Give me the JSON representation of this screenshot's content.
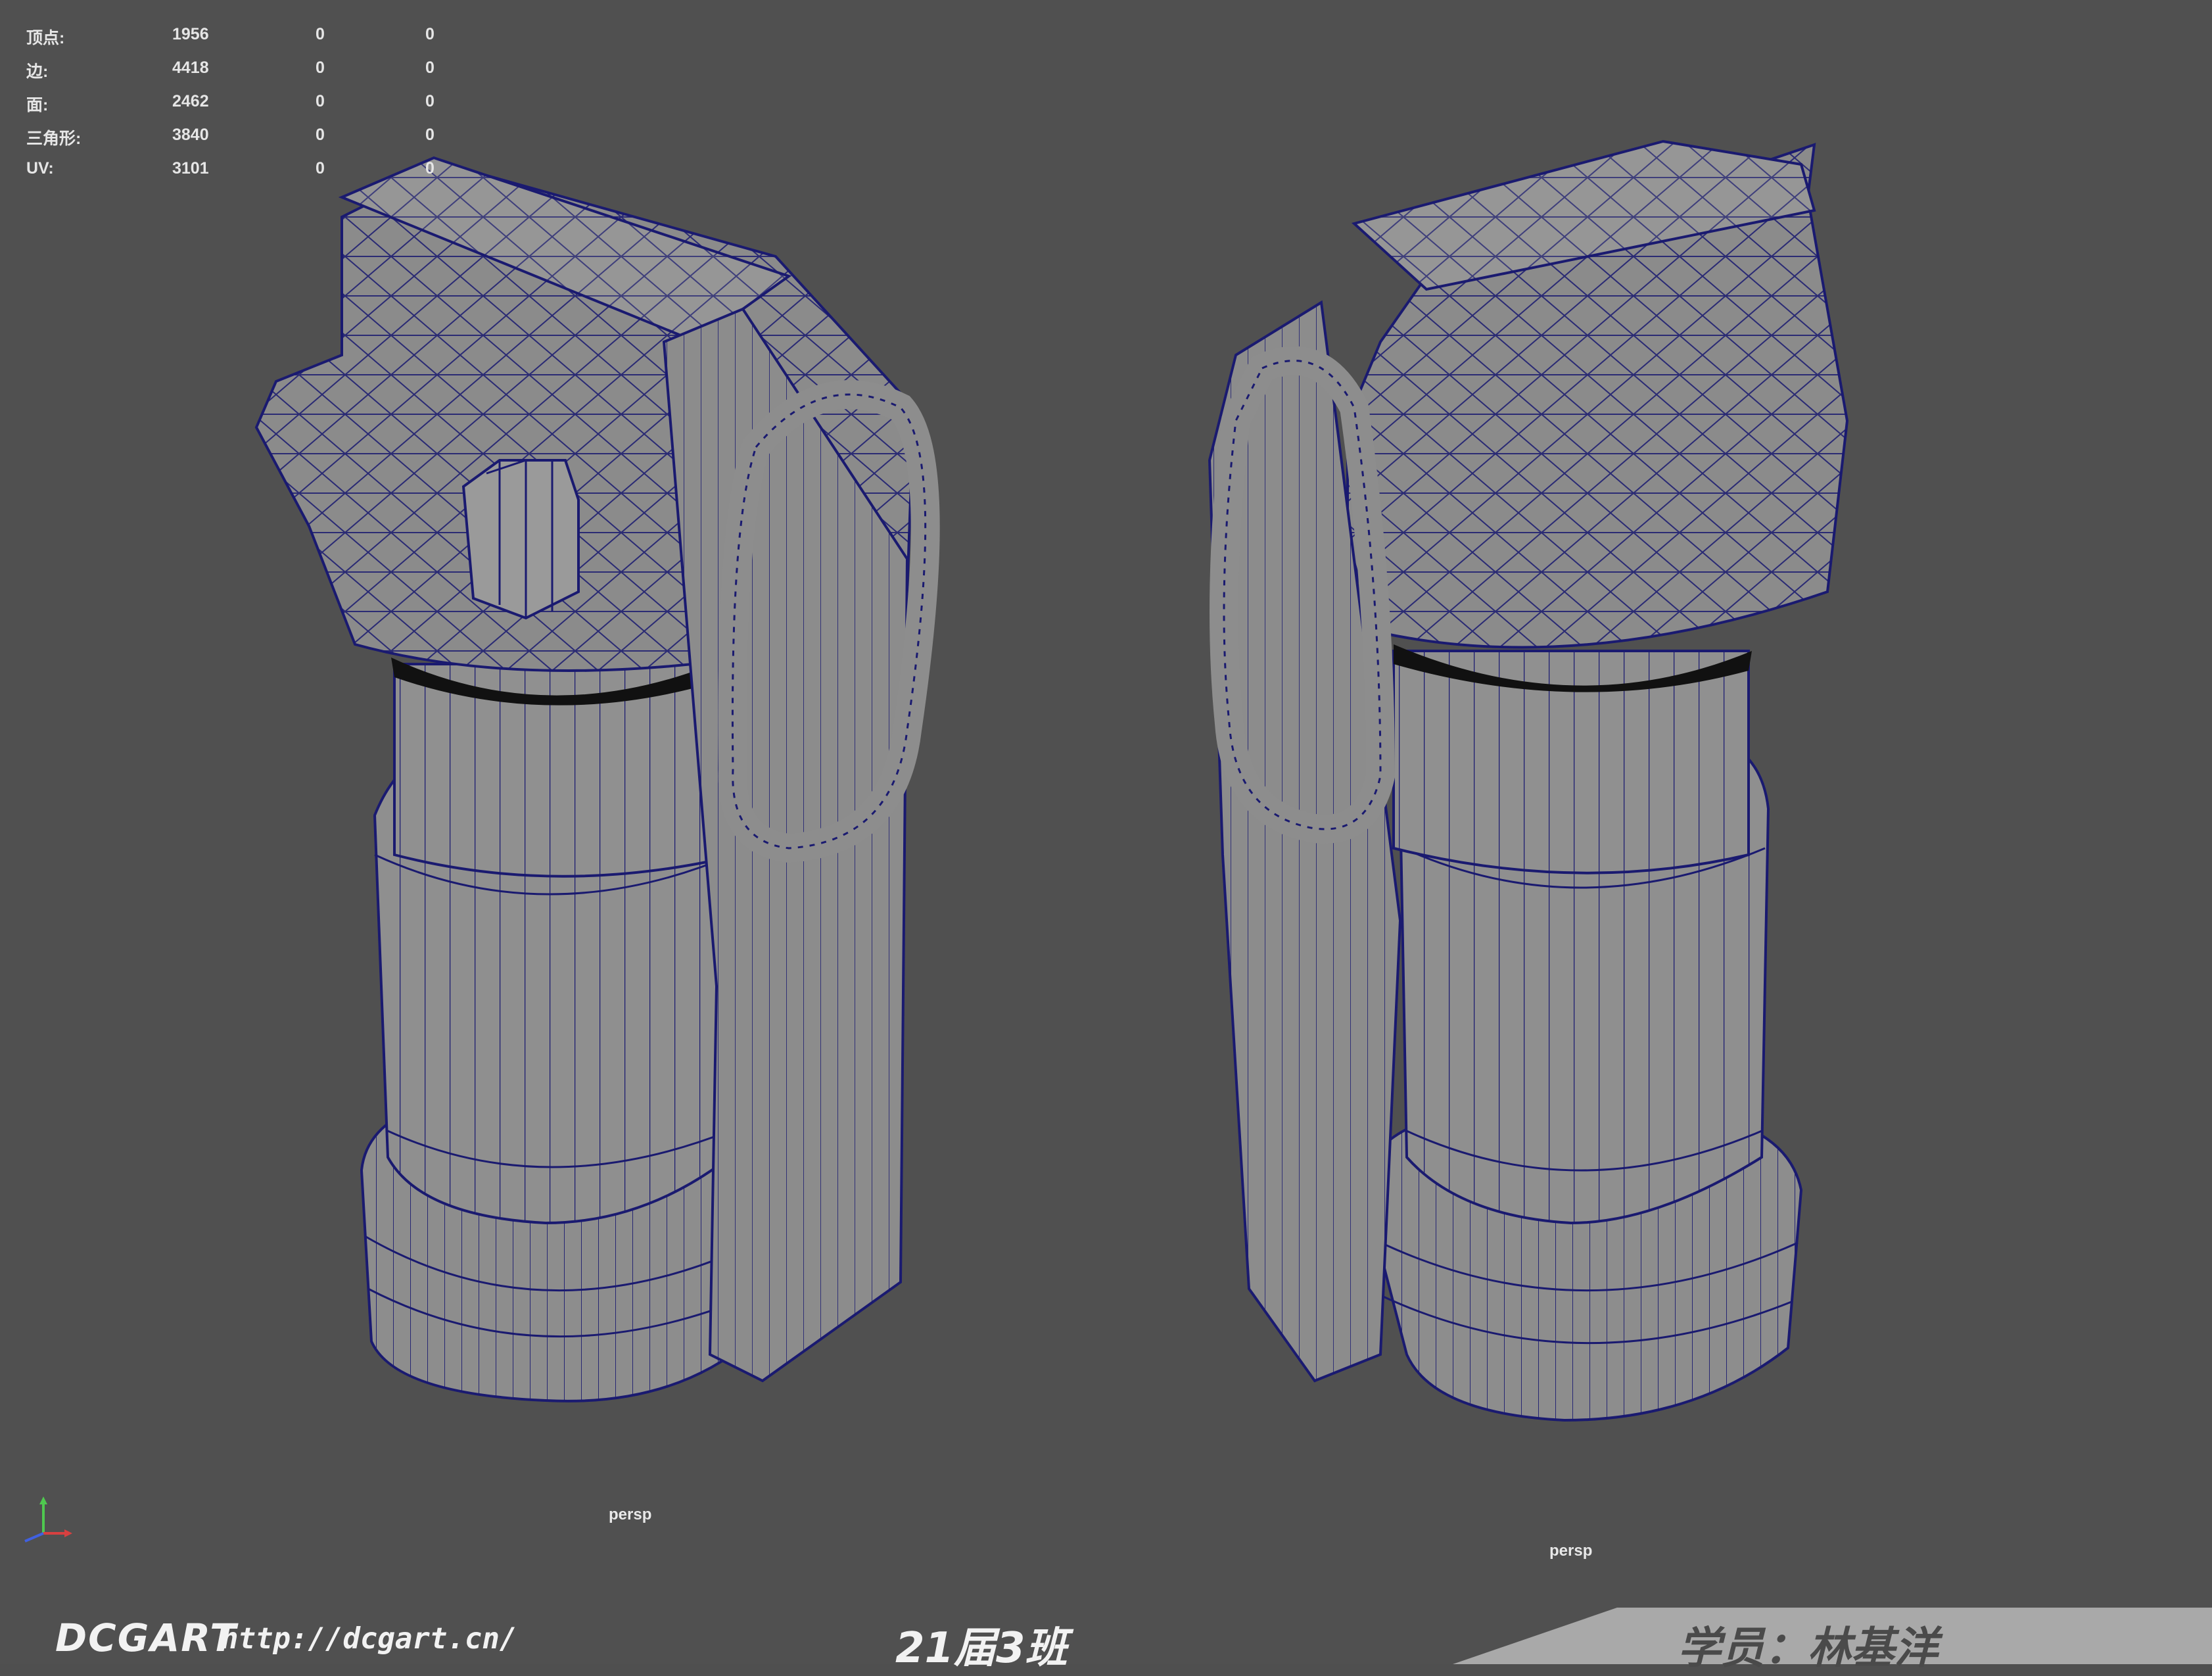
{
  "hud": {
    "rows": [
      {
        "label": "顶点:",
        "values": [
          "1956",
          "0",
          "0"
        ]
      },
      {
        "label": "边:",
        "values": [
          "4418",
          "0",
          "0"
        ]
      },
      {
        "label": "面:",
        "values": [
          "2462",
          "0",
          "0"
        ]
      },
      {
        "label": "三角形:",
        "values": [
          "3840",
          "0",
          "0"
        ]
      },
      {
        "label": "UV:",
        "values": [
          "3101",
          "0",
          "0"
        ]
      }
    ]
  },
  "viewports": {
    "left_camera": "persp",
    "right_camera": "persp"
  },
  "axis": {
    "y": "y",
    "x": "x",
    "z": "z"
  },
  "banner": {
    "brand": "DCGART",
    "url": "http://dcgart.cn/",
    "class_label": "21届3班",
    "student": "学员：林基洋"
  },
  "colors": {
    "viewport_bg": "#505050",
    "mesh_fill": "#8c8c8c",
    "wireframe": "#1a1a70",
    "banner_light": "#a9a9a9"
  }
}
